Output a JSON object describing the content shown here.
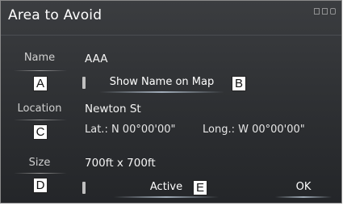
{
  "window": {
    "title": "Area to Avoid"
  },
  "status_icons": [
    "signal-icon",
    "hd-icon"
  ],
  "fields": {
    "name": {
      "label": "Name",
      "value": "AAA",
      "callout": "A"
    },
    "show_name": {
      "label": "Show Name on Map",
      "callout": "B"
    },
    "location": {
      "label": "Location",
      "value": "Newton St",
      "callout": "C",
      "lat": "Lat.: N 00°00'00\"",
      "long": "Long.: W 00°00'00\""
    },
    "size": {
      "label": "Size",
      "value": "700ft x 700ft",
      "callout": "D"
    },
    "active": {
      "label": "Active",
      "callout": "E"
    }
  },
  "buttons": {
    "ok": "OK"
  }
}
